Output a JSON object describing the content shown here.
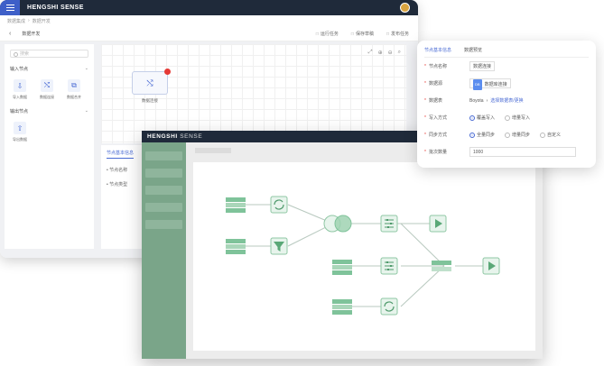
{
  "back_window": {
    "brand": "HENGSHI SENSE",
    "breadcrumb": [
      "数据集成",
      "数据开发"
    ],
    "page_title": "数据开发",
    "actions": [
      "运行任务",
      "保存草稿",
      "发布任务"
    ],
    "search_placeholder": "搜索",
    "groups": [
      {
        "title": "输入节点",
        "items": [
          {
            "icon": "import-icon",
            "glyph": "⇩",
            "label": "导入数据"
          },
          {
            "icon": "join-icon",
            "glyph": "⤭",
            "label": "数据连接"
          },
          {
            "icon": "union-icon",
            "glyph": "⧉",
            "label": "数据合并"
          }
        ]
      },
      {
        "title": "输出节点",
        "items": [
          {
            "icon": "export-icon",
            "glyph": "⇧",
            "label": "导出数据"
          }
        ]
      }
    ],
    "canvas_node_label": "数据连接",
    "panel_tab": "节点基本信息",
    "panel_items": [
      "节点名称",
      "节点类型"
    ]
  },
  "front_window": {
    "brand_bold": "HENGSHI",
    "brand_thin": " SENSE"
  },
  "properties": {
    "tabs": [
      "节点基本信息",
      "数据预览"
    ],
    "rows": [
      {
        "label": "节点名称",
        "value": "数据连接"
      },
      {
        "label": "数据源",
        "badge": "DB",
        "value": "数据库连接"
      },
      {
        "label": "数据表",
        "value": "Boyota",
        "link": "选择数据表/更换"
      },
      {
        "label": "写入方式",
        "options": [
          "覆盖写入",
          "增量写入"
        ],
        "selected": 0
      },
      {
        "label": "同步方式",
        "options": [
          "全量同步",
          "增量同步",
          "自定义"
        ],
        "selected": 0
      },
      {
        "label": "批次数量",
        "value": "1000"
      }
    ]
  },
  "colors": {
    "topbar": "#1f2a3a",
    "accent": "#4a6bd4",
    "flow_green": "#7fc39a",
    "front_sidebar": "#7aa589"
  }
}
